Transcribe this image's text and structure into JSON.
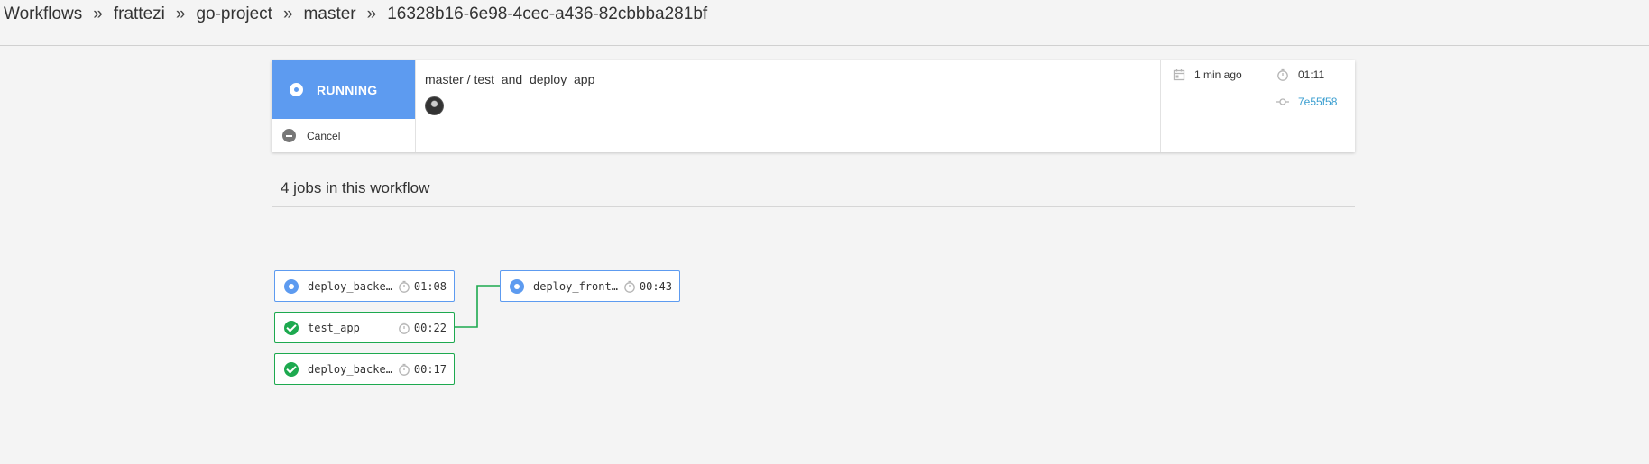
{
  "breadcrumb": {
    "items": [
      "Workflows",
      "frattezi",
      "go-project",
      "master",
      "16328b16-6e98-4cec-a436-82cbbba281bf"
    ],
    "separator": "»"
  },
  "workflow": {
    "status": "RUNNING",
    "cancel_label": "Cancel",
    "title": "master / test_and_deploy_app",
    "started": "1 min ago",
    "duration": "01:11",
    "commit": "7e55f58"
  },
  "jobs_section": {
    "title": "4 jobs in this workflow"
  },
  "jobs": [
    {
      "name": "deploy_backend",
      "display": "deploy_backe…",
      "duration": "01:08",
      "status": "running"
    },
    {
      "name": "test_app",
      "display": "test_app",
      "duration": "00:22",
      "status": "success"
    },
    {
      "name": "deploy_backend",
      "display": "deploy_backe…",
      "duration": "00:17",
      "status": "success"
    },
    {
      "name": "deploy_frontend",
      "display": "deploy_front…",
      "duration": "00:43",
      "status": "running"
    }
  ],
  "colors": {
    "running": "#5d9bf0",
    "success": "#1da94f",
    "link": "#3a9ed0"
  }
}
